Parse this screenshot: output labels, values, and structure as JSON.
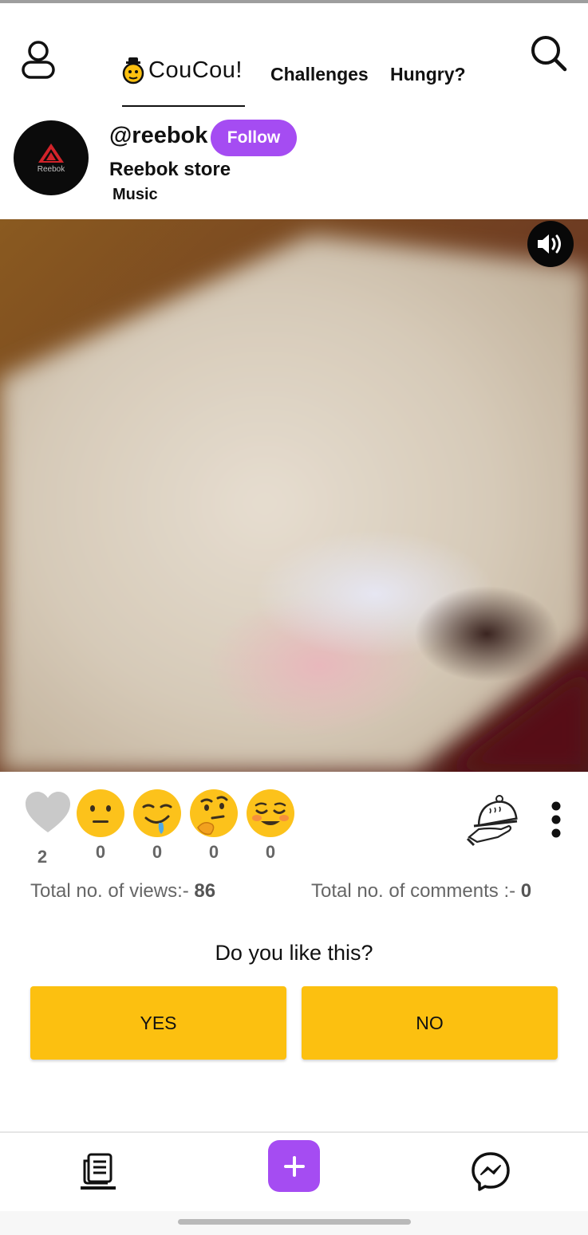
{
  "header": {
    "brand_name": "CouCou!",
    "tabs": [
      {
        "label": "Challenges"
      },
      {
        "label": "Hungry?"
      }
    ]
  },
  "account": {
    "handle": "@reebok",
    "avatar_text": "Reebok",
    "follow_label": "Follow",
    "store_name": "Reebok store",
    "category": "Music"
  },
  "reactions": [
    {
      "name": "heart-icon",
      "count": "2"
    },
    {
      "name": "neutral-face-icon",
      "count": "0"
    },
    {
      "name": "drooling-face-icon",
      "count": "0"
    },
    {
      "name": "thinking-face-icon",
      "count": "0"
    },
    {
      "name": "relieved-face-icon",
      "count": "0"
    }
  ],
  "stats": {
    "views_label": "Total no. of views:- ",
    "views_value": "86",
    "comments_label": "Total no. of comments :- ",
    "comments_value": "0"
  },
  "poll": {
    "question": "Do you like this?",
    "yes_label": "YES",
    "no_label": "NO"
  },
  "colors": {
    "accent_purple": "#a54cf2",
    "poll_button_yellow": "#fcc010"
  }
}
